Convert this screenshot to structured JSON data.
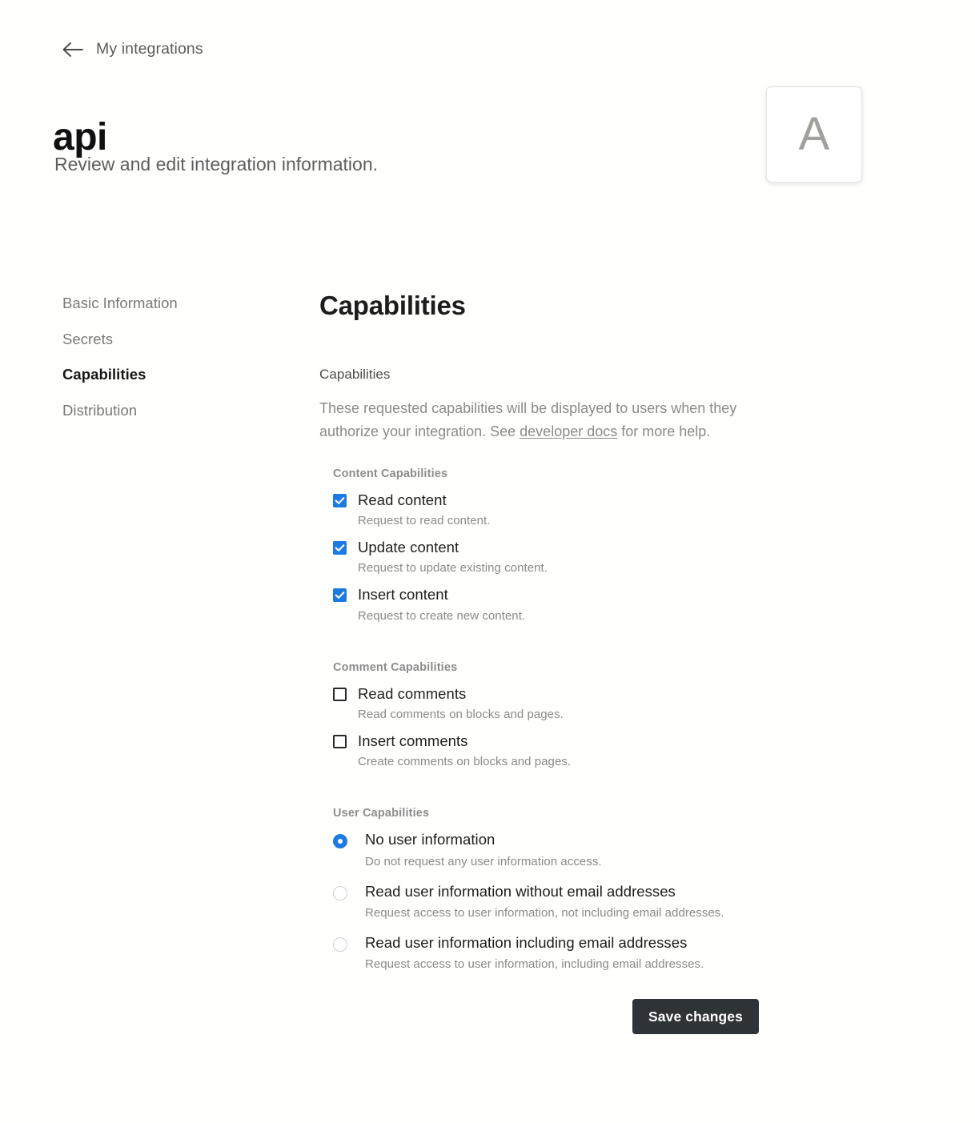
{
  "header": {
    "back_icon": "arrow-left-icon",
    "breadcrumb_label": "My integrations",
    "title": "api",
    "subtitle": "Review and edit integration information.",
    "avatar_letter": "A"
  },
  "sidebar": {
    "items": [
      {
        "label": "Basic Information",
        "active": false
      },
      {
        "label": "Secrets",
        "active": false
      },
      {
        "label": "Capabilities",
        "active": true
      },
      {
        "label": "Distribution",
        "active": false
      }
    ]
  },
  "main": {
    "section_title": "Capabilities",
    "field_label": "Capabilities",
    "description_before_link": "These requested capabilities will be displayed to users when they authorize your integration. See ",
    "description_link": "developer docs",
    "description_after_link": " for more help.",
    "groups": [
      {
        "title": "Content Capabilities",
        "type": "checkbox",
        "options": [
          {
            "label": "Read content",
            "desc": "Request to read content.",
            "checked": true
          },
          {
            "label": "Update content",
            "desc": "Request to update existing content.",
            "checked": true
          },
          {
            "label": "Insert content",
            "desc": "Request to create new content.",
            "checked": true
          }
        ]
      },
      {
        "title": "Comment Capabilities",
        "type": "checkbox",
        "options": [
          {
            "label": "Read comments",
            "desc": "Read comments on blocks and pages.",
            "checked": false
          },
          {
            "label": "Insert comments",
            "desc": "Create comments on blocks and pages.",
            "checked": false
          }
        ]
      },
      {
        "title": "User Capabilities",
        "type": "radio",
        "options": [
          {
            "label": "No user information",
            "desc": "Do not request any user information access.",
            "checked": true
          },
          {
            "label": "Read user information without email addresses",
            "desc": "Request access to user information, not including email addresses.",
            "checked": false
          },
          {
            "label": "Read user information including email addresses",
            "desc": "Request access to user information, including email addresses.",
            "checked": false
          }
        ]
      }
    ]
  },
  "footer": {
    "save_label": "Save changes"
  },
  "colors": {
    "accent_blue": "#1d7ae0",
    "button_dark": "#2e3338",
    "muted_text": "#8a8a8a",
    "background": "#fffffe"
  }
}
